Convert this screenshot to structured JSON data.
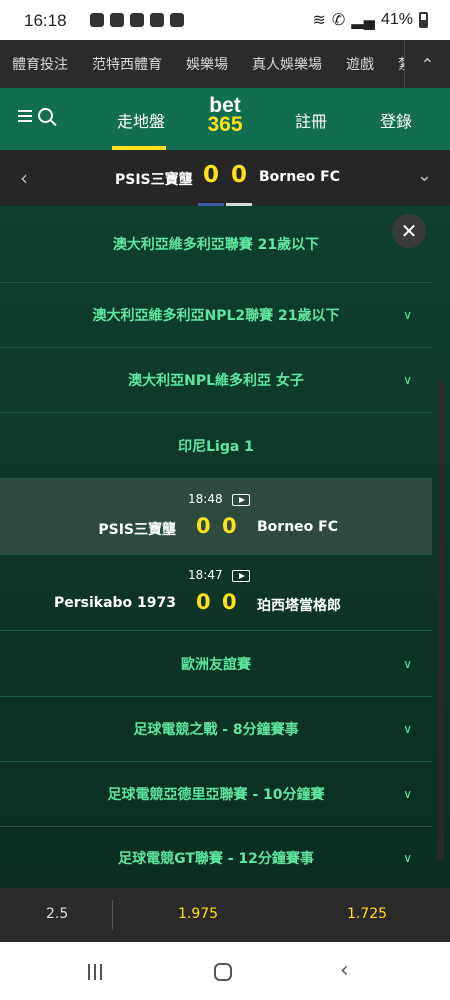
{
  "status_bar": {
    "time": "16:18",
    "battery": "41%"
  },
  "top_nav": {
    "items": [
      "體育投注",
      "范特西體育",
      "娛樂場",
      "真人娛樂場",
      "遊戲",
      "紮"
    ]
  },
  "header": {
    "live_label": "走地盤",
    "logo_line1": "bet",
    "logo_line2": "365",
    "register_label": "註冊",
    "login_label": "登錄"
  },
  "scoreboard": {
    "home_team": "PSIS三寶壟",
    "home_score": "0",
    "away_score": "0",
    "away_team": "Borneo FC"
  },
  "overlay": {
    "competitions_top": [
      "澳大利亞維多利亞聯賽 21歲以下",
      "澳大利亞維多利亞NPL2聯賽 21歲以下",
      "澳大利亞NPL維多利亞 女子",
      "印尼Liga 1"
    ],
    "matches": [
      {
        "time": "18:48",
        "home": "PSIS三寶壟",
        "home_score": "0",
        "away_score": "0",
        "away": "Borneo FC"
      },
      {
        "time": "18:47",
        "home": "Persikabo 1973",
        "home_score": "0",
        "away_score": "0",
        "away": "珀西塔當格郎"
      }
    ],
    "competitions_bottom": [
      "歐洲友誼賽",
      "足球電競之戰 - 8分鐘賽事",
      "足球電競亞德里亞聯賽 - 10分鐘賽",
      "足球電競GT聯賽 - 12分鐘賽事"
    ]
  },
  "odds_bar": {
    "handicap": "2.5",
    "over": "1.975",
    "under": "1.725"
  },
  "colors": {
    "brand_green": "#126e51",
    "accent_yellow": "#ffdf1b",
    "list_text_green": "#5ee6a0"
  }
}
